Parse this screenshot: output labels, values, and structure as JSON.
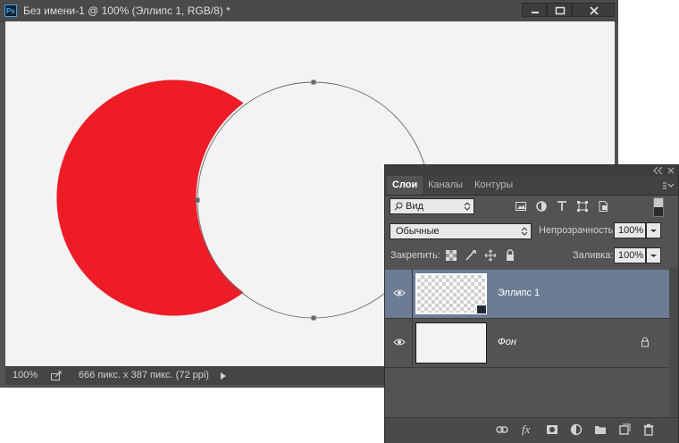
{
  "document": {
    "title": "Без имени-1 @ 100% (Эллипс 1, RGB/8) *",
    "app_icon": "Ps",
    "zoom": "100%",
    "info": "666 пикс. x 387 пикс. (72 ppi)"
  },
  "window_buttons": [
    "minimize-icon",
    "restore-icon",
    "close-icon"
  ],
  "canvas_colors": {
    "background": "#f3f3f3",
    "shape_fill": "#ee1c27"
  },
  "panel": {
    "tabs": [
      {
        "label": "Слои",
        "active": true
      },
      {
        "label": "Каналы",
        "active": false
      },
      {
        "label": "Контуры",
        "active": false
      }
    ],
    "filter": {
      "label": "Вид"
    },
    "filter_icons": [
      "image-filter-icon",
      "adjustment-filter-icon",
      "type-filter-icon",
      "shape-filter-icon",
      "smart-object-filter-icon"
    ],
    "blend_mode": "Обычные",
    "opacity_label": "Непрозрачность:",
    "opacity_value": "100%",
    "lock_label": "Закрепить:",
    "fill_label": "Заливка:",
    "fill_value": "100%",
    "layers": [
      {
        "name": "Эллипс 1",
        "selected": true,
        "visible": true,
        "locked": false
      },
      {
        "name": "Фон",
        "selected": false,
        "visible": true,
        "locked": true
      }
    ],
    "bottom_icons": [
      "link-layers-icon",
      "fx-icon",
      "add-mask-icon",
      "adjustment-layer-icon",
      "new-group-icon",
      "new-layer-icon",
      "delete-layer-icon"
    ],
    "fx_label": "fx"
  }
}
